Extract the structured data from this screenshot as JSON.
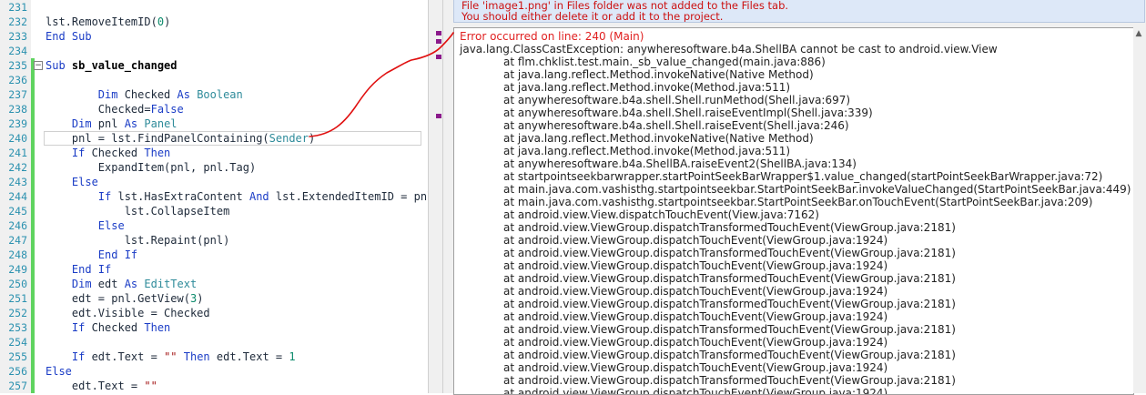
{
  "editor": {
    "lines": [
      {
        "no": "231",
        "code": []
      },
      {
        "no": "232",
        "code": [
          [
            "lst.RemoveItemID(",
            "p"
          ],
          [
            "0",
            "num"
          ],
          [
            ")",
            "p"
          ]
        ]
      },
      {
        "no": "233",
        "code": [
          [
            "End Sub",
            "kw"
          ]
        ]
      },
      {
        "no": "234",
        "code": []
      },
      {
        "no": "235",
        "code": [
          [
            "Sub ",
            "kw"
          ],
          [
            "sb_value_changed",
            "sub"
          ]
        ]
      },
      {
        "no": "236",
        "code": []
      },
      {
        "no": "237",
        "code": [
          [
            "        Dim ",
            "kw"
          ],
          [
            "Checked ",
            "p"
          ],
          [
            "As ",
            "kw"
          ],
          [
            "Boolean",
            "ty"
          ]
        ]
      },
      {
        "no": "238",
        "code": [
          [
            "        Checked=",
            "p"
          ],
          [
            "False",
            "kw"
          ]
        ]
      },
      {
        "no": "239",
        "code": [
          [
            "    Dim ",
            "kw"
          ],
          [
            "pnl ",
            "p"
          ],
          [
            "As ",
            "kw"
          ],
          [
            "Panel",
            "ty"
          ]
        ]
      },
      {
        "no": "240",
        "code": [
          [
            "    pnl = lst.FindPanelContaining(",
            "p"
          ],
          [
            "Sender",
            "ty"
          ],
          [
            ")",
            "p"
          ]
        ]
      },
      {
        "no": "241",
        "code": [
          [
            "    If ",
            "kw"
          ],
          [
            "Checked ",
            "p"
          ],
          [
            "Then",
            "kw"
          ]
        ]
      },
      {
        "no": "242",
        "code": [
          [
            "        ExpandItem(pnl, pnl.Tag)",
            "p"
          ]
        ]
      },
      {
        "no": "243",
        "code": [
          [
            "    Else",
            "kw"
          ]
        ]
      },
      {
        "no": "244",
        "code": [
          [
            "        If ",
            "kw"
          ],
          [
            "lst.HasExtraContent ",
            "p"
          ],
          [
            "And ",
            "kw"
          ],
          [
            "lst.ExtendedItemID = pnl",
            "p"
          ]
        ]
      },
      {
        "no": "245",
        "code": [
          [
            "            lst.CollapseItem",
            "p"
          ]
        ]
      },
      {
        "no": "246",
        "code": [
          [
            "        Else",
            "kw"
          ]
        ]
      },
      {
        "no": "247",
        "code": [
          [
            "            lst.Repaint(pnl)",
            "p"
          ]
        ]
      },
      {
        "no": "248",
        "code": [
          [
            "        End If",
            "kw"
          ]
        ]
      },
      {
        "no": "249",
        "code": [
          [
            "    End If",
            "kw"
          ]
        ]
      },
      {
        "no": "250",
        "code": [
          [
            "    Dim ",
            "kw"
          ],
          [
            "edt ",
            "p"
          ],
          [
            "As ",
            "kw"
          ],
          [
            "EditText",
            "ty"
          ]
        ]
      },
      {
        "no": "251",
        "code": [
          [
            "    edt = pnl.GetView(",
            "p"
          ],
          [
            "3",
            "num"
          ],
          [
            ")",
            "p"
          ]
        ]
      },
      {
        "no": "252",
        "code": [
          [
            "    edt.Visible = Checked",
            "p"
          ]
        ]
      },
      {
        "no": "253",
        "code": [
          [
            "    If ",
            "kw"
          ],
          [
            "Checked ",
            "p"
          ],
          [
            "Then",
            "kw"
          ]
        ]
      },
      {
        "no": "254",
        "code": []
      },
      {
        "no": "255",
        "code": [
          [
            "    If ",
            "kw"
          ],
          [
            "edt.Text = ",
            "p"
          ],
          [
            "\"\" ",
            "str"
          ],
          [
            "Then ",
            "kw"
          ],
          [
            "edt.Text = ",
            "p"
          ],
          [
            "1",
            "num"
          ]
        ]
      },
      {
        "no": "256",
        "code": [
          [
            "Else",
            "kw"
          ]
        ]
      },
      {
        "no": "257",
        "code": [
          [
            "    edt.Text = ",
            "p"
          ],
          [
            "\"\"",
            "str"
          ]
        ]
      }
    ]
  },
  "logs": {
    "warning": [
      "File 'image1.png' in Files folder was not added to the Files tab.",
      "You should either delete it or add it to the project."
    ],
    "error_header": "Error occurred on line: 240 (Main)",
    "exception": "java.lang.ClassCastException: anywheresoftware.b4a.ShellBA cannot be cast to android.view.View",
    "stack": [
      "at flm.chklist.test.main._sb_value_changed(main.java:886)",
      "at java.lang.reflect.Method.invokeNative(Native Method)",
      "at java.lang.reflect.Method.invoke(Method.java:511)",
      "at anywheresoftware.b4a.shell.Shell.runMethod(Shell.java:697)",
      "at anywheresoftware.b4a.shell.Shell.raiseEventImpl(Shell.java:339)",
      "at anywheresoftware.b4a.shell.Shell.raiseEvent(Shell.java:246)",
      "at java.lang.reflect.Method.invokeNative(Native Method)",
      "at java.lang.reflect.Method.invoke(Method.java:511)",
      "at anywheresoftware.b4a.ShellBA.raiseEvent2(ShellBA.java:134)",
      "at startpointseekbarwrapper.startPointSeekBarWrapper$1.value_changed(startPointSeekBarWrapper.java:72)",
      "at main.java.com.vashisthg.startpointseekbar.StartPointSeekBar.invokeValueChanged(StartPointSeekBar.java:449)",
      "at main.java.com.vashisthg.startpointseekbar.StartPointSeekBar.onTouchEvent(StartPointSeekBar.java:209)",
      "at android.view.View.dispatchTouchEvent(View.java:7162)",
      "at android.view.ViewGroup.dispatchTransformedTouchEvent(ViewGroup.java:2181)",
      "at android.view.ViewGroup.dispatchTouchEvent(ViewGroup.java:1924)",
      "at android.view.ViewGroup.dispatchTransformedTouchEvent(ViewGroup.java:2181)",
      "at android.view.ViewGroup.dispatchTouchEvent(ViewGroup.java:1924)",
      "at android.view.ViewGroup.dispatchTransformedTouchEvent(ViewGroup.java:2181)",
      "at android.view.ViewGroup.dispatchTouchEvent(ViewGroup.java:1924)",
      "at android.view.ViewGroup.dispatchTransformedTouchEvent(ViewGroup.java:2181)",
      "at android.view.ViewGroup.dispatchTouchEvent(ViewGroup.java:1924)",
      "at android.view.ViewGroup.dispatchTransformedTouchEvent(ViewGroup.java:2181)",
      "at android.view.ViewGroup.dispatchTouchEvent(ViewGroup.java:1924)",
      "at android.view.ViewGroup.dispatchTransformedTouchEvent(ViewGroup.java:2181)",
      "at android.view.ViewGroup.dispatchTouchEvent(ViewGroup.java:1924)",
      "at android.view.ViewGroup.dispatchTransformedTouchEvent(ViewGroup.java:2181)",
      "at android.view.ViewGroup.dispatchTouchEvent(ViewGroup.java:1924)",
      "at android.view.ViewGroup.dispatchTransformedTouchEvent(ViewGroup.java:2181)"
    ]
  },
  "icons": {
    "scroll_up": "▲",
    "fold_marker": "−"
  },
  "colors": {
    "error": "#e02020",
    "annotation": "#e01010",
    "marker": "#8b1a8b"
  }
}
